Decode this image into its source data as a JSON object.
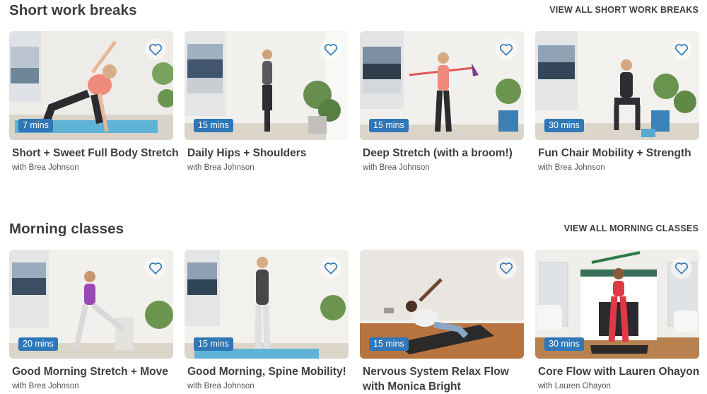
{
  "sections": [
    {
      "title": "Short work breaks",
      "view_all": "VIEW ALL SHORT WORK BREAKS",
      "cards": [
        {
          "title": "Short + Sweet Full Body Stretch",
          "instructor": "with Brea Johnson",
          "duration": "7 mins"
        },
        {
          "title": "Daily Hips + Shoulders",
          "instructor": "with Brea Johnson",
          "duration": "15 mins"
        },
        {
          "title": "Deep Stretch (with a broom!)",
          "instructor": "with Brea Johnson",
          "duration": "15 mins"
        },
        {
          "title": "Fun Chair Mobility + Strength",
          "instructor": "with Brea Johnson",
          "duration": "30 mins"
        }
      ]
    },
    {
      "title": "Morning classes",
      "view_all": "VIEW ALL MORNING CLASSES",
      "cards": [
        {
          "title": "Good Morning Stretch + Move",
          "instructor": "with Brea Johnson",
          "duration": "20 mins"
        },
        {
          "title": "Good Morning, Spine Mobility!",
          "instructor": "with Brea Johnson",
          "duration": "15 mins"
        },
        {
          "title": "Nervous System Relax Flow with Monica Bright",
          "instructor": "",
          "duration": "15 mins"
        },
        {
          "title": "Core Flow with Lauren Ohayon",
          "instructor": "with Lauren Ohayon",
          "duration": "30 mins"
        }
      ]
    }
  ],
  "colors": {
    "accent": "#2f77b7",
    "heart": "#2f77b7"
  },
  "icons": {
    "favorite": "heart-outline-icon"
  }
}
